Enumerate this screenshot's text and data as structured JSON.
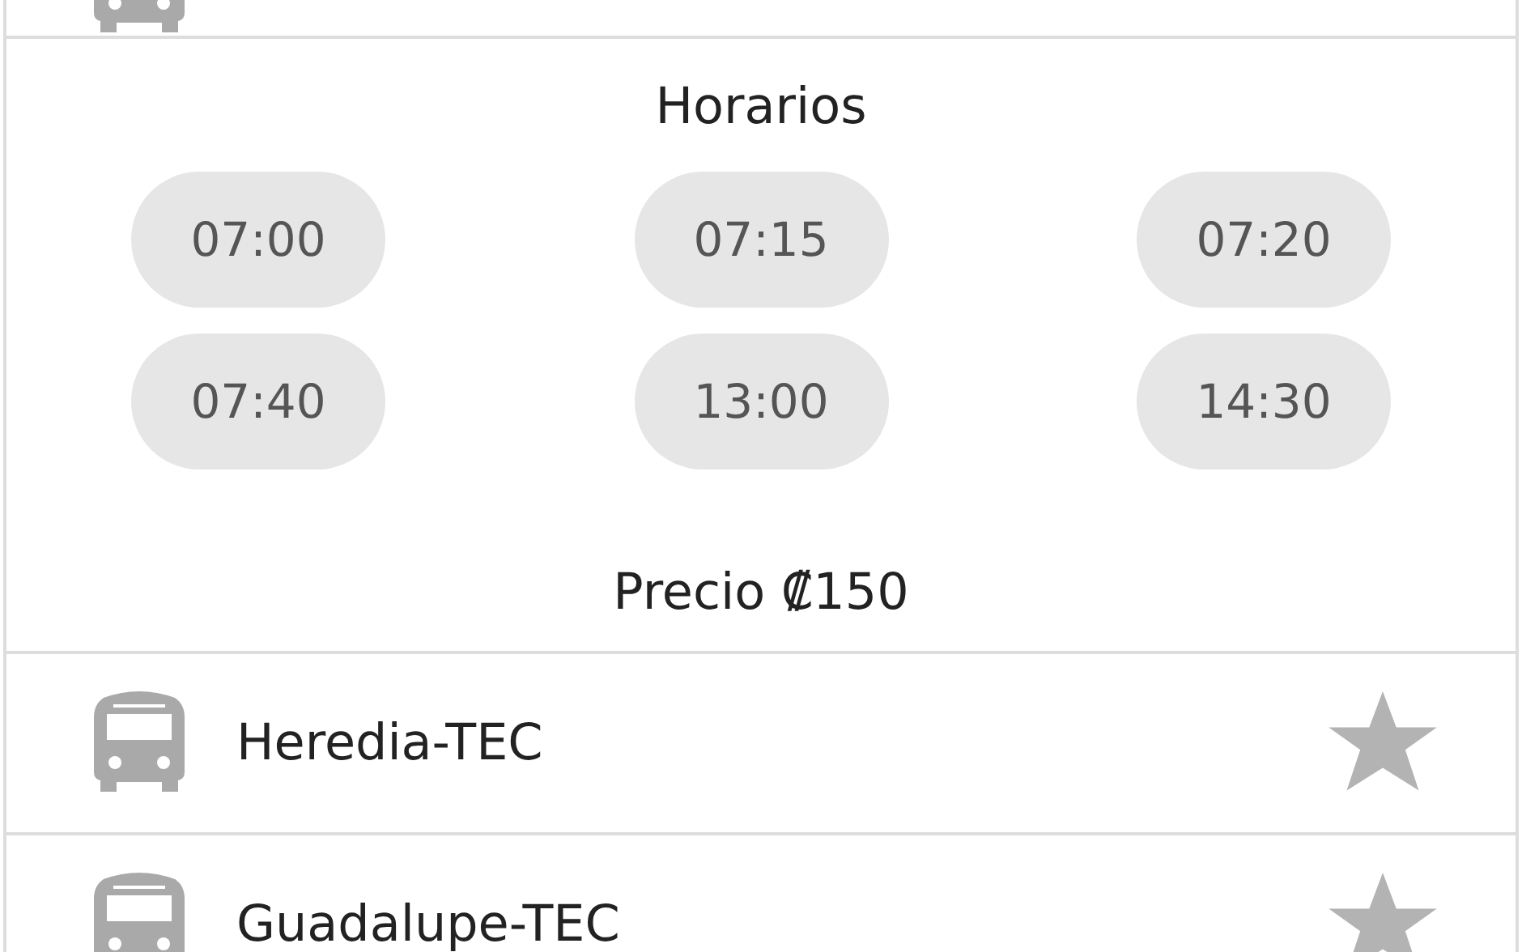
{
  "schedule": {
    "title": "Horarios",
    "times": [
      {
        "label": "07:00"
      },
      {
        "label": "07:15"
      },
      {
        "label": "07:20"
      },
      {
        "label": "07:40"
      },
      {
        "label": "13:00"
      },
      {
        "label": "14:30"
      }
    ],
    "price": "Precio ₡150"
  },
  "routes": [
    {
      "name": "Heredia-TEC",
      "favorite": false
    },
    {
      "name": "Guadalupe-TEC",
      "favorite": false
    }
  ]
}
